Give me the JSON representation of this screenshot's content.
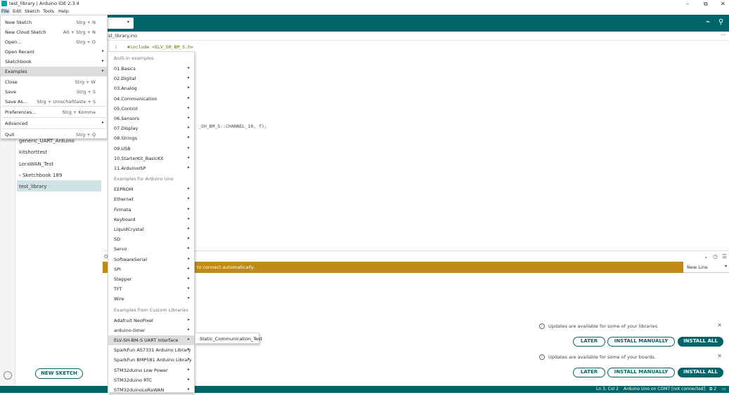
{
  "window": {
    "title": "test_library | Arduino IDE 2.3.4",
    "minimize": "–",
    "maximize": "⧉",
    "close": "✕"
  },
  "menubar": [
    "File",
    "Edit",
    "Sketch",
    "Tools",
    "Help"
  ],
  "toolbar": {
    "dropdown_arrow": "▾",
    "serial_plotter": "⌁",
    "serial_monitor": "⚲"
  },
  "file_menu": [
    {
      "label": "New Sketch",
      "shortcut": "Strg + N"
    },
    {
      "label": "New Cloud Sketch",
      "shortcut": "Alt + Strg + N"
    },
    {
      "label": "Open...",
      "shortcut": "Strg + O"
    },
    {
      "label": "Open Recent",
      "arrow": "▸"
    },
    {
      "label": "Sketchbook",
      "arrow": "▸"
    },
    {
      "label": "Examples",
      "arrow": "▸"
    },
    {
      "label": "Close",
      "shortcut": "Strg + W"
    },
    {
      "label": "Save",
      "shortcut": "Strg + S"
    },
    {
      "label": "Save As...",
      "shortcut": "Strg + Umschalttaste + S"
    },
    {
      "label": "Preferences...",
      "shortcut": "Strg + Komma"
    },
    {
      "label": "Advanced",
      "arrow": "▸"
    },
    {
      "label": "Quit",
      "shortcut": "Strg + Q"
    }
  ],
  "examples_menu": {
    "header_builtin": "Built-in examples",
    "builtin": [
      "01.Basics",
      "02.Digital",
      "03.Analog",
      "04.Communication",
      "05.Control",
      "06.Sensors",
      "07.Display",
      "08.Strings",
      "09.USB",
      "10.StarterKit_BasicKit",
      "11.ArduinoISP"
    ],
    "header_board": "Examples for Arduino Uno",
    "board": [
      "EEPROM",
      "Ethernet",
      "Firmata",
      "Keyboard",
      "LiquidCrystal",
      "SD",
      "Servo",
      "SoftwareSerial",
      "SPI",
      "Stepper",
      "TFT",
      "Wire"
    ],
    "header_custom": "Examples from Custom Libraries",
    "custom": [
      "Adafruit NeoPixel",
      "arduino-timer",
      "ELV-SH-BM-S UART Interface",
      "SparkFun AS7331 Arduino Library",
      "SparkFun BMP581 Arduino Library",
      "STM32duino Low Power",
      "STM32duino RTC",
      "STM32duinoLoRaWAN"
    ],
    "arrow": "▸"
  },
  "submenu_item": "Static_Communication_Test",
  "sketchbook": {
    "items": [
      "generic_UART_Arduino",
      "kitshorttest",
      "LoraWAN_Test"
    ],
    "folder": "Sketchbook 189",
    "folder_chevron": "›",
    "selected": "test_library",
    "new_sketch": "NEW SKETCH"
  },
  "editor": {
    "tab": "st_library.ino",
    "more": "⋯",
    "line_number": "1",
    "line1": "#include <ELV_SH_BM_S.h>",
    "line_partial": "_SH_BM_S::CHANNEL_10, f);"
  },
  "output": {
    "label": "O",
    "banner": "to connect automatically.",
    "line_ending": "New Line",
    "line_ending_arrow": "▾",
    "icons": [
      "⌄",
      "◷",
      "☰"
    ]
  },
  "notifications": [
    {
      "message": "Updates are available for some of your libraries.",
      "later": "LATER",
      "manual": "INSTALL MANUALLY",
      "all": "INSTALL ALL",
      "close": "✕",
      "info": "i"
    },
    {
      "message": "Updates are available for some of your boards.",
      "later": "LATER",
      "manual": "INSTALL MANUALLY",
      "all": "INSTALL ALL",
      "close": "✕",
      "info": "i"
    }
  ],
  "statusbar": {
    "position": "Ln 3, Col 2",
    "board": "Arduino Uno on COM7 [not connected]",
    "notifications": "⧉ 2",
    "panel": "▭"
  },
  "colors": {
    "teal": "#006468",
    "orange": "#c18a12",
    "selected": "#cfe3e4"
  }
}
